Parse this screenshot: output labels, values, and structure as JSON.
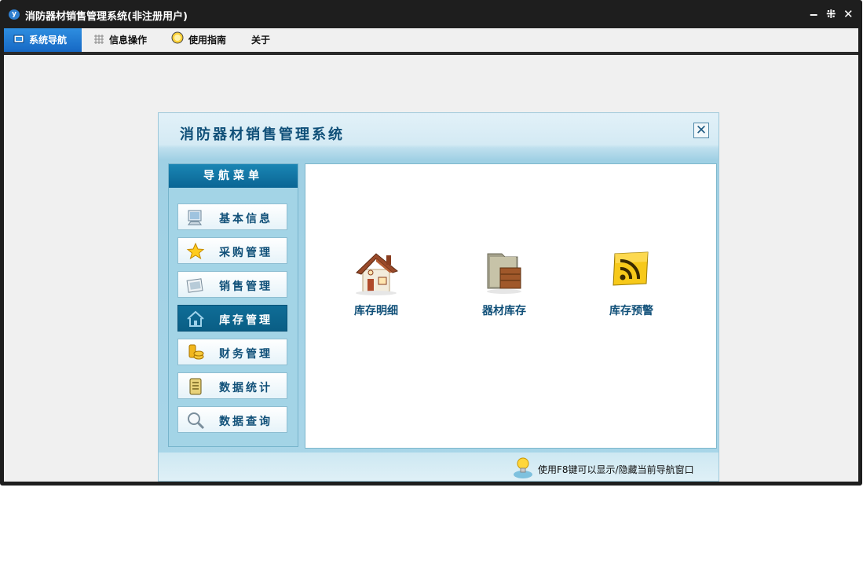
{
  "window": {
    "title": "消防器材销售管理系统(非注册用户)",
    "logo_letter": "y",
    "buttons": {
      "minimize": "‒",
      "restore": "⁜",
      "close": "✕"
    }
  },
  "menu": [
    {
      "label": "系统导航",
      "icon": "monitor-icon",
      "active": true
    },
    {
      "label": "信息操作",
      "icon": "grid-icon",
      "active": false
    },
    {
      "label": "使用指南",
      "icon": "bulb-icon",
      "active": false
    },
    {
      "label": "关于",
      "icon": "",
      "active": false
    }
  ],
  "dialog": {
    "title": "消防器材销售管理系统",
    "close_glyph": "✕",
    "nav_header": "导航菜单",
    "nav_items": [
      {
        "label": "基本信息",
        "icon": "monitor-icon",
        "active": false
      },
      {
        "label": "采购管理",
        "icon": "star-icon",
        "active": false
      },
      {
        "label": "销售管理",
        "icon": "photo-icon",
        "active": false
      },
      {
        "label": "库存管理",
        "icon": "house-icon",
        "active": true
      },
      {
        "label": "财务管理",
        "icon": "coins-icon",
        "active": false
      },
      {
        "label": "数据统计",
        "icon": "scroll-icon",
        "active": false
      },
      {
        "label": "数据查询",
        "icon": "magnifier-icon",
        "active": false
      }
    ],
    "functions": [
      {
        "label": "库存明细",
        "icon": "house-icon"
      },
      {
        "label": "器材库存",
        "icon": "folder-box-icon"
      },
      {
        "label": "库存预警",
        "icon": "rss-icon"
      }
    ],
    "status_tip": "使用F8键可以显示/隐藏当前导航窗口"
  },
  "colors": {
    "accent": "#1668c4",
    "nav_active": "#0a5e85",
    "label": "#0f4f78"
  }
}
